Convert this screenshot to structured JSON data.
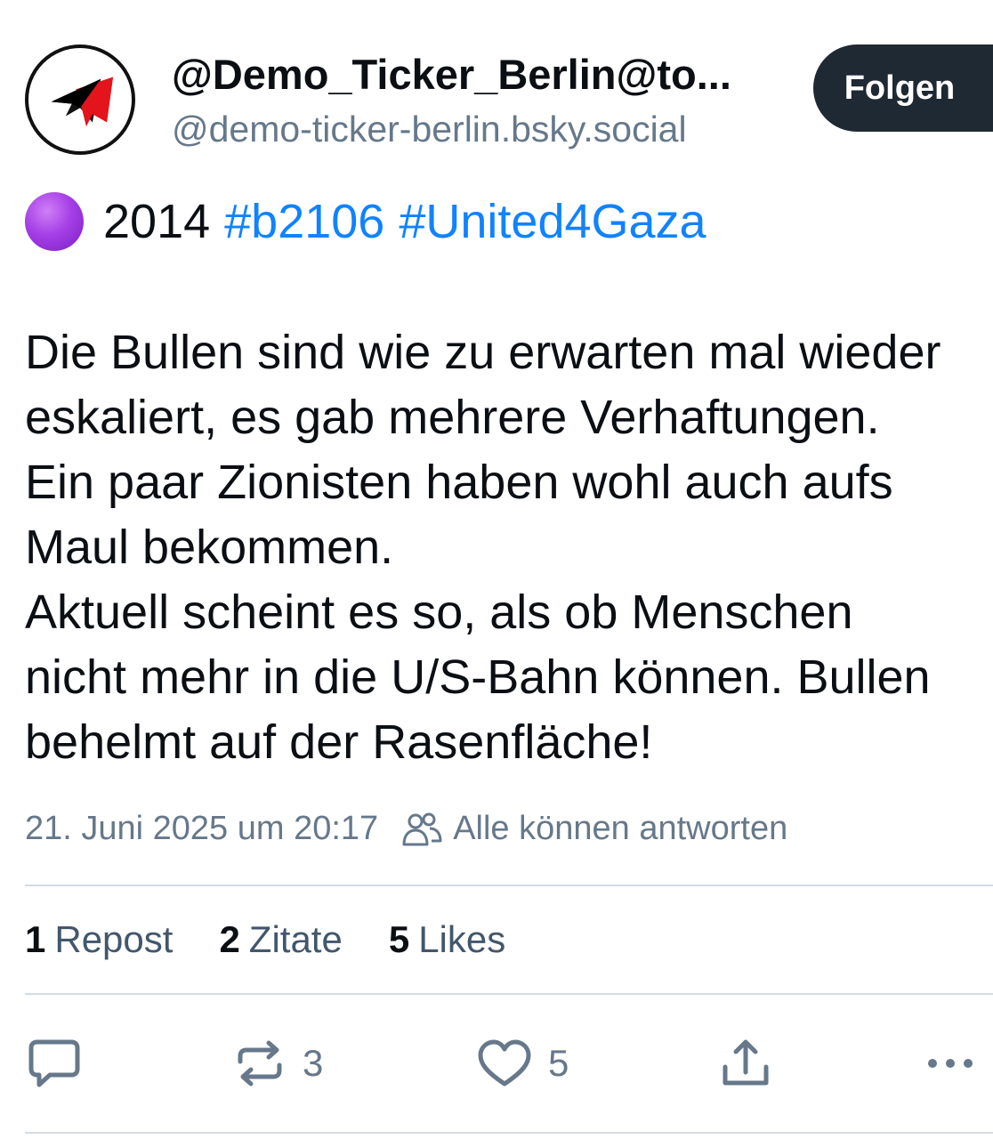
{
  "post": {
    "author": {
      "display_name": "@Demo_Ticker_Berlin@to...",
      "handle": "@demo-ticker-berlin.bsky.social",
      "avatar_icon": "antifa-flags-logo"
    },
    "follow_label": "Folgen",
    "tag_line": {
      "emoji_icon": "purple-circle-icon",
      "year": "2014",
      "hashtags": [
        "#b2106",
        "#United4Gaza"
      ]
    },
    "body_lines": [
      "Die Bullen sind wie zu erwarten mal wieder",
      "eskaliert, es gab mehrere Verhaftungen.",
      "Ein paar Zionisten haben wohl auch aufs",
      "Maul bekommen.",
      "Aktuell scheint es so, als ob Menschen",
      "nicht mehr in die U/S-Bahn können. Bullen",
      "behelmt auf der Rasenfläche!"
    ],
    "timestamp": "21. Juni 2025 um 20:17",
    "reply_setting": "Alle können antworten",
    "stats": {
      "reposts": {
        "count": "1",
        "label": "Repost"
      },
      "quotes": {
        "count": "2",
        "label": "Zitate"
      },
      "likes": {
        "count": "5",
        "label": "Likes"
      }
    },
    "actions": {
      "reply_icon": "speech-bubble-icon",
      "repost_icon": "repost-arrows-icon",
      "repost_count": "3",
      "like_icon": "heart-icon",
      "like_count": "5",
      "share_icon": "share-icon",
      "more_icon": "more-dots-icon"
    }
  },
  "colors": {
    "link": "#1083fe",
    "muted": "#66788a",
    "button_bg": "#1f2933",
    "divider": "#d4dbe2"
  }
}
